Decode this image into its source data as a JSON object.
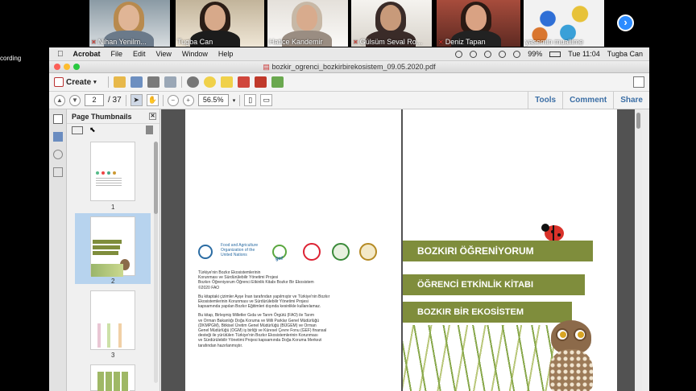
{
  "zoom": {
    "participants": [
      {
        "name": "Nihan Yenilm...",
        "muted": true
      },
      {
        "name": "Tugba Can",
        "muted": false
      },
      {
        "name": "Hatice Kandemir",
        "muted": false
      },
      {
        "name": "Gülsüm Seval Ro...",
        "muted": true
      },
      {
        "name": "Deniz Tapan",
        "muted": true
      },
      {
        "name": "yasemin muallime",
        "muted": false
      }
    ],
    "recording_label": "cording",
    "next_icon": "chevron-right-icon"
  },
  "menubar": {
    "app": "Acrobat",
    "items": [
      "File",
      "Edit",
      "View",
      "Window",
      "Help"
    ],
    "battery": "99%",
    "clock": "Tue 11:04",
    "user": "Tugba Can"
  },
  "document": {
    "filename": "bozkir_ogrenci_bozkirbirekosistem_09.05.2020.pdf"
  },
  "toolbar": {
    "create_label": "Create",
    "current_page": "2",
    "total_pages": "/ 37",
    "zoom": "56.5%",
    "tools_label": "Tools",
    "comment_label": "Comment",
    "share_label": "Share"
  },
  "thumbnails": {
    "title": "Page Thumbnails",
    "pages": [
      "1",
      "2",
      "3"
    ]
  },
  "page_left": {
    "fao_name": "Food and Agriculture Organization of the United Nations",
    "gef": "gef",
    "paragraphs": [
      "Türkiye'nin Bozkır Ekosistemlerinin\nKorunması ve Sürdürülebilir Yönetimi Projesi\nBozkırı Öğreniyorum Öğrenci Etkinlik Kitabı Bozkır Bir Ekosistem\n©2020 FAO",
      "Bu kitaptaki çizimler Ayşe İnan tarafından yapılmıştır ve Türkiye'nin Bozkır\nEkosistemlerinin Korunması ve Sürdürülebilir Yönetimi Projesi\nkapsamında yapılan Bozkır Eğitimleri dışında kesinlikle kullanılamaz.",
      "Bu kitap, Birleşmiş Milletler Gıda ve Tarım Örgütü (FAO) ile Tarım\nve Orman Bakanlığı Doğa Koruma ve Milli Parklar Genel Müdürlüğü\n(DKMPGM), Bitkisel Üretim Genel Müdürlüğü (BÜGEM) ve Orman\nGenel Müdürlüğü (OGM) iş birliği ve Küresel Çevre Fonu (GEF) finansal\ndesteği ile yürütülen Türkiye'nin Bozkır Ekosistemlerinin Korunması\nve Sürdürülebilir Yönetimi Projesi kapsamında Doğa Koruma Merkezi\ntarafından hazırlanmıştır."
    ]
  },
  "page_right": {
    "banner1": "BOZKIRI ÖĞRENİYORUM",
    "banner2": "ÖĞRENCİ ETKİNLİK KİTABI",
    "banner3": "BOZKIR BİR EKOSİSTEM"
  }
}
